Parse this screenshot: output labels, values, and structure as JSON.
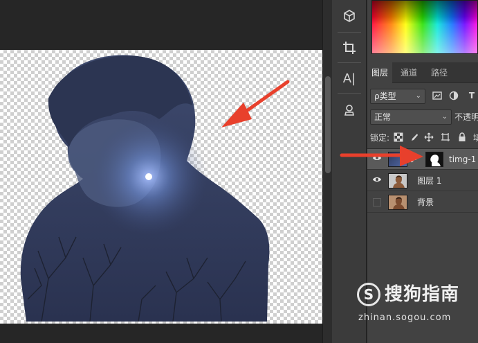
{
  "tools": [
    {
      "icon": "3d-cube-icon"
    },
    {
      "icon": "crop-icon"
    },
    {
      "icon": "type-tool-icon",
      "glyph": "A|"
    },
    {
      "icon": "stamp-icon"
    }
  ],
  "panel": {
    "tabs": [
      {
        "label": "图层",
        "active": true
      },
      {
        "label": "通道",
        "active": false
      },
      {
        "label": "路径",
        "active": false
      }
    ],
    "filter": {
      "label": "ρ类型",
      "glyph_t": "T"
    },
    "blend_mode": "正常",
    "opacity_label": "不透明",
    "lock_label": "锁定:",
    "fill_label": "填"
  },
  "layers": [
    {
      "name": "timg-1",
      "visible": true,
      "selected": true,
      "has_mask": true
    },
    {
      "name": "图层 1",
      "visible": true,
      "selected": false,
      "has_mask": false
    },
    {
      "name": "背景",
      "visible": false,
      "selected": false,
      "has_mask": false
    }
  ],
  "watermark": {
    "logo_glyph": "S",
    "text": "搜狗指南",
    "url": "zhinan.sogou.com"
  },
  "colors": {
    "accent_arrow": "#e8402c",
    "panel_bg": "#424242",
    "canvas_bg": "#262626"
  }
}
